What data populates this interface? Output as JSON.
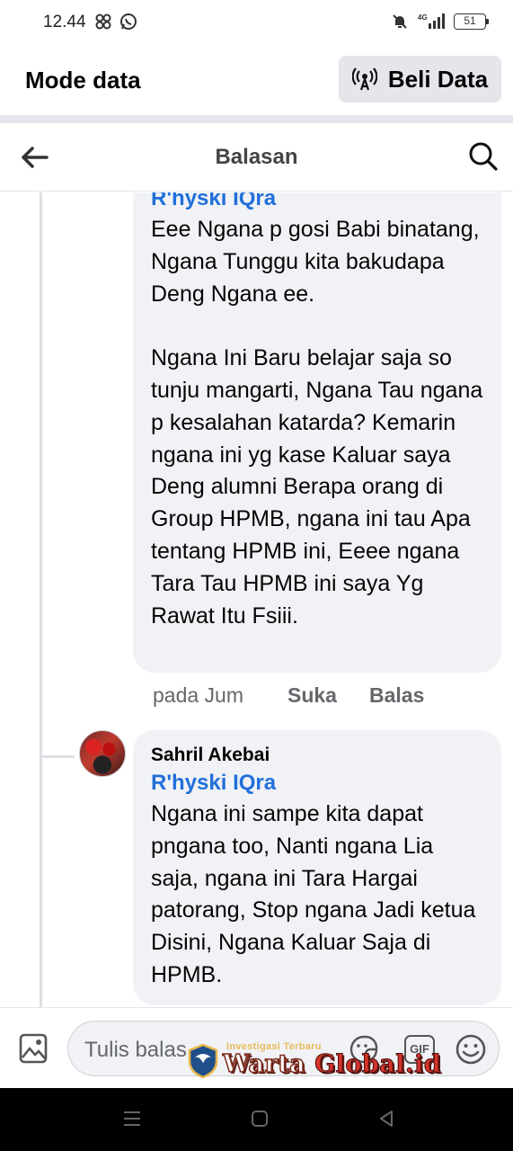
{
  "status_bar": {
    "time": "12.44",
    "battery": "51",
    "left_icons": [
      "pinwheel-icon",
      "whatsapp-icon"
    ],
    "right_icons": [
      "mute-icon",
      "4g-signal-icon",
      "battery-icon"
    ]
  },
  "mode_bar": {
    "title": "Mode data",
    "buy_label": "Beli Data"
  },
  "header": {
    "title": "Balasan"
  },
  "comments": [
    {
      "mention": "R'hyski IQra",
      "text": "Eee Ngana p gosi Babi binatang, Ngana Tunggu kita bakudapa Deng Ngana ee.\n\nNgana Ini Baru belajar saja so tunju mangarti, Ngana Tau ngana p kesalahan katarda? Kemarin ngana ini yg kase Kaluar saya Deng alumni Berapa orang di Group HPMB, ngana ini tau Apa tentang HPMB ini, Eeee ngana Tara Tau HPMB ini saya Yg Rawat Itu Fsiii.",
      "time": "pada Jum",
      "like": "Suka",
      "reply": "Balas"
    },
    {
      "author": "Sahril Akebai",
      "mention": "R'hyski IQra",
      "text": "Ngana ini sampe kita dapat pngana too, Nanti ngana Lia saja, ngana ini Tara Hargai patorang, Stop ngana Jadi ketua Disini, Ngana Kaluar Saja di HPMB."
    }
  ],
  "composer": {
    "placeholder": "Tulis balas..."
  },
  "watermark": {
    "tagline": "Investigasi Terbaru",
    "brand_part1": "Warta",
    "brand_part2": "Global",
    "brand_part3": ".id"
  },
  "colors": {
    "mention": "#216fdb",
    "bubble": "#f0f2f5",
    "muted_text": "#65676b",
    "button_bg": "#e4e6eb"
  }
}
